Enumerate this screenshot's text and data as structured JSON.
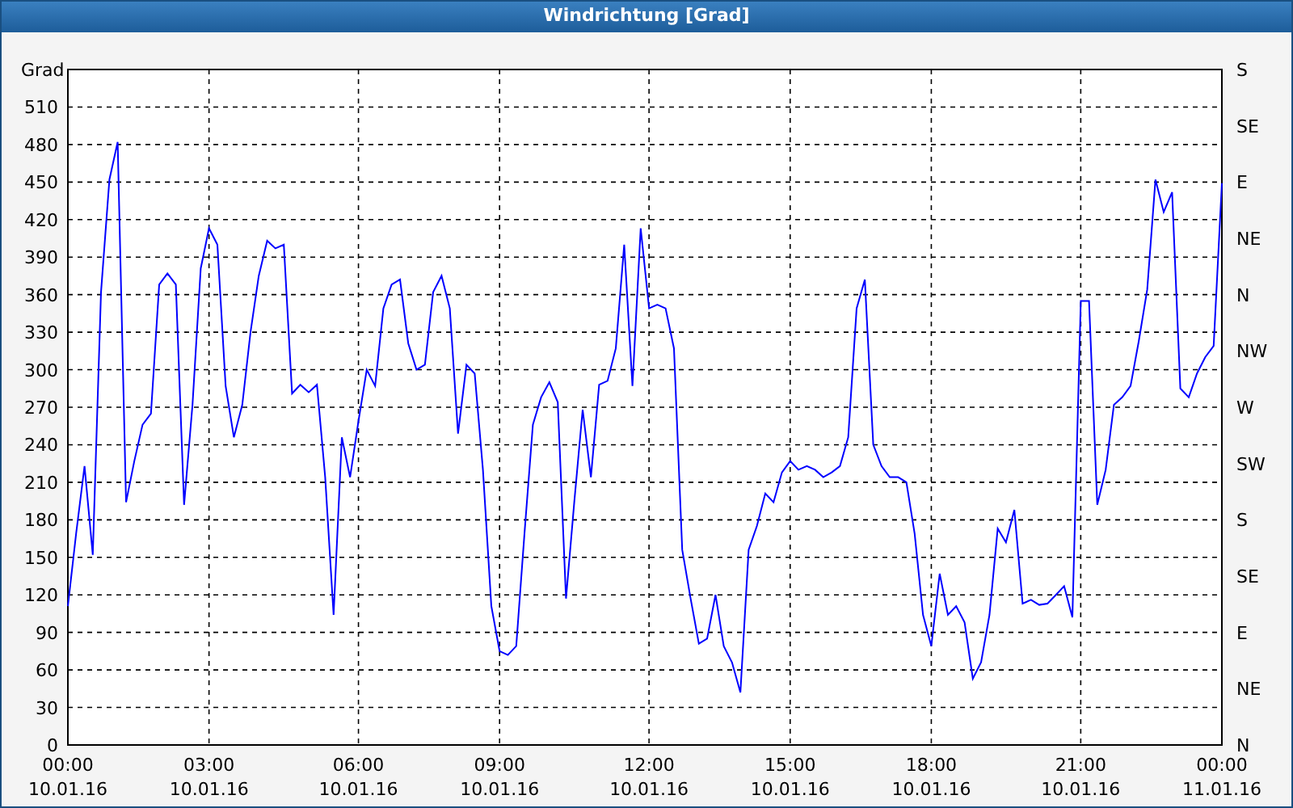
{
  "window": {
    "title": "Windrichtung [Grad]"
  },
  "chart": {
    "chart_data": {
      "type": "line",
      "grid": true,
      "ylabel": "Grad",
      "ylim": [
        0,
        540
      ],
      "yticks": [
        0,
        30,
        60,
        90,
        120,
        150,
        180,
        210,
        240,
        270,
        300,
        330,
        360,
        390,
        420,
        450,
        480,
        510
      ],
      "categories": [
        "00:00\n10.01.16",
        null,
        null,
        null,
        null,
        null,
        null,
        null,
        null,
        null,
        null,
        null,
        null,
        null,
        null,
        null,
        null,
        "03:00\n10.01.16",
        null,
        null,
        null,
        null,
        null,
        null,
        null,
        null,
        null,
        null,
        null,
        null,
        null,
        null,
        null,
        null,
        null,
        "06:00\n10.01.16",
        null,
        null,
        null,
        null,
        null,
        null,
        null,
        null,
        null,
        null,
        null,
        null,
        null,
        null,
        null,
        null,
        "09:00\n10.01.16",
        null,
        null,
        null,
        null,
        null,
        null,
        null,
        null,
        null,
        null,
        null,
        null,
        null,
        null,
        null,
        null,
        null,
        "12:00\n10.01.16",
        null,
        null,
        null,
        null,
        null,
        null,
        null,
        null,
        null,
        null,
        null,
        null,
        null,
        null,
        null,
        null,
        "15:00\n10.01.16",
        null,
        null,
        null,
        null,
        null,
        null,
        null,
        null,
        null,
        null,
        null,
        null,
        null,
        null,
        null,
        null,
        "18:00\n10.01.16",
        null,
        null,
        null,
        null,
        null,
        null,
        null,
        null,
        null,
        null,
        null,
        null,
        null,
        null,
        null,
        null,
        null,
        "21:00\n10.01.16",
        null,
        null,
        null,
        null,
        null,
        null,
        null,
        null,
        null,
        null,
        null,
        null,
        null,
        null,
        null,
        null,
        "00:00\n11.01.16"
      ],
      "series": [
        {
          "color": "#0000ff",
          "values": [
            111,
            169,
            223,
            152,
            362,
            452,
            482,
            194,
            227,
            256,
            265,
            368,
            377,
            368,
            192,
            272,
            381,
            413,
            400,
            287,
            246,
            272,
            330,
            375,
            403,
            397,
            400,
            281,
            288,
            282,
            288,
            214,
            104,
            246,
            214,
            259,
            300,
            287,
            349,
            368,
            372,
            321,
            300,
            304,
            362,
            375,
            349,
            249,
            304,
            297,
            220,
            111,
            75,
            72,
            79,
            169,
            256,
            278,
            290,
            274,
            117,
            194,
            268,
            214,
            288,
            291,
            317,
            400,
            287,
            413,
            349,
            352,
            349,
            317,
            156,
            117,
            81,
            85,
            120,
            79,
            66,
            42,
            156,
            175,
            201,
            194,
            218,
            227,
            220,
            223,
            220,
            214,
            218,
            223,
            246,
            349,
            372,
            240,
            223,
            214,
            214,
            210,
            169,
            104,
            79,
            137,
            104,
            111,
            98,
            53,
            66,
            104,
            173,
            162,
            188,
            113,
            116,
            112,
            113,
            120,
            127,
            102,
            355,
            355,
            192,
            220,
            272,
            278,
            287,
            323,
            364,
            452,
            426,
            442,
            285,
            278,
            297,
            310,
            319,
            449
          ]
        }
      ]
    },
    "right_axis_labels": [
      "S",
      "SE",
      "E",
      "NE",
      "N",
      "NW",
      "W",
      "SW",
      "S",
      "SE",
      "E",
      "NE",
      "N"
    ]
  }
}
